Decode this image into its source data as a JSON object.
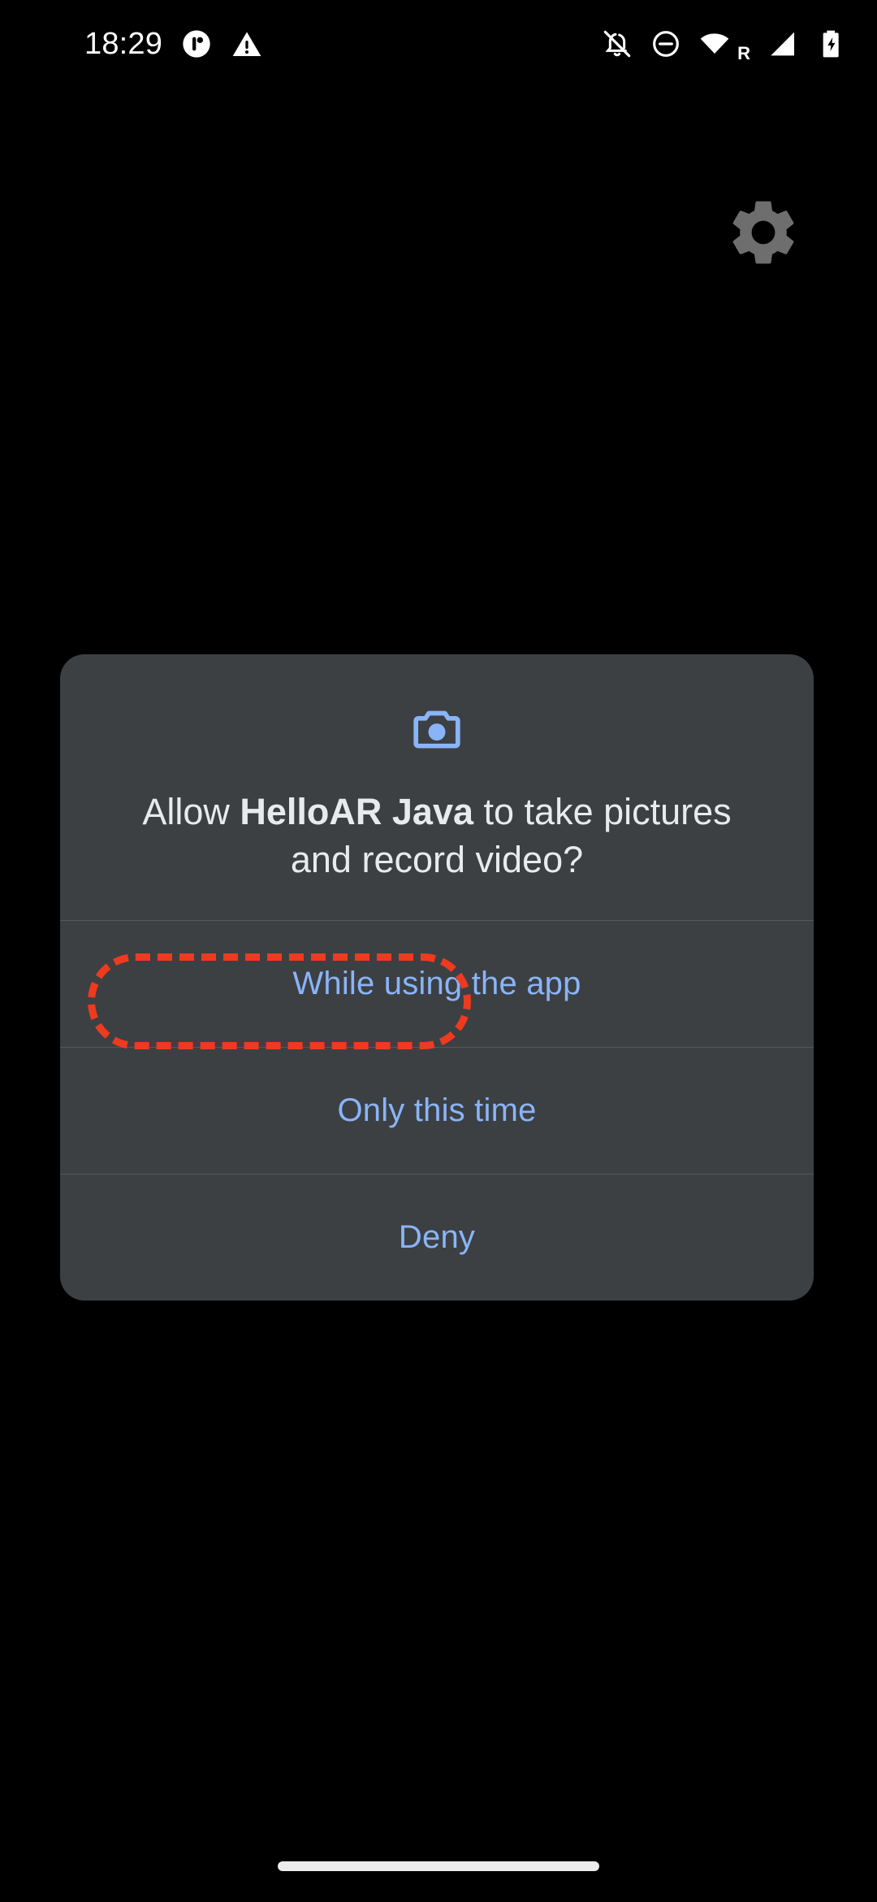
{
  "status_bar": {
    "clock": "18:29",
    "left_icons": [
      {
        "name": "app-notification-icon",
        "glyph": "circle-split"
      },
      {
        "name": "warning-triangle-icon",
        "glyph": "warning"
      }
    ],
    "right_icons": [
      {
        "name": "notifications-silenced-icon",
        "glyph": "bell-slash"
      },
      {
        "name": "do-not-disturb-icon",
        "glyph": "circle-minus"
      },
      {
        "name": "wifi-icon",
        "glyph": "wifi"
      },
      {
        "name": "roaming-indicator",
        "glyph": "R",
        "label": "R"
      },
      {
        "name": "cellular-signal-icon",
        "glyph": "signal-triangle"
      },
      {
        "name": "battery-charging-icon",
        "glyph": "battery-bolt"
      }
    ]
  },
  "app": {
    "settings_icon": "gear-icon",
    "settings_icon_color": "#6E6E6E",
    "background_color": "#000000"
  },
  "dialog": {
    "icon": "camera-icon",
    "icon_color": "#8AB4F8",
    "surface_color": "#3C4043",
    "title_prefix": "Allow ",
    "title_app_name": "HelloAR Java",
    "title_suffix": " to take pictures and record video?",
    "buttons": [
      {
        "id": "while-using-the-app",
        "label": "While using the app",
        "highlighted": true
      },
      {
        "id": "only-this-time",
        "label": "Only this time",
        "highlighted": false
      },
      {
        "id": "deny",
        "label": "Deny",
        "highlighted": false
      }
    ],
    "button_text_color": "#8AB4F8"
  },
  "annotation": {
    "target": "While using the app",
    "style": "dashed-rounded-rectangle",
    "color": "#EE3A1F"
  },
  "nav_bar": {
    "home_indicator": "gesture-home-pill",
    "color": "#EDEDED"
  }
}
